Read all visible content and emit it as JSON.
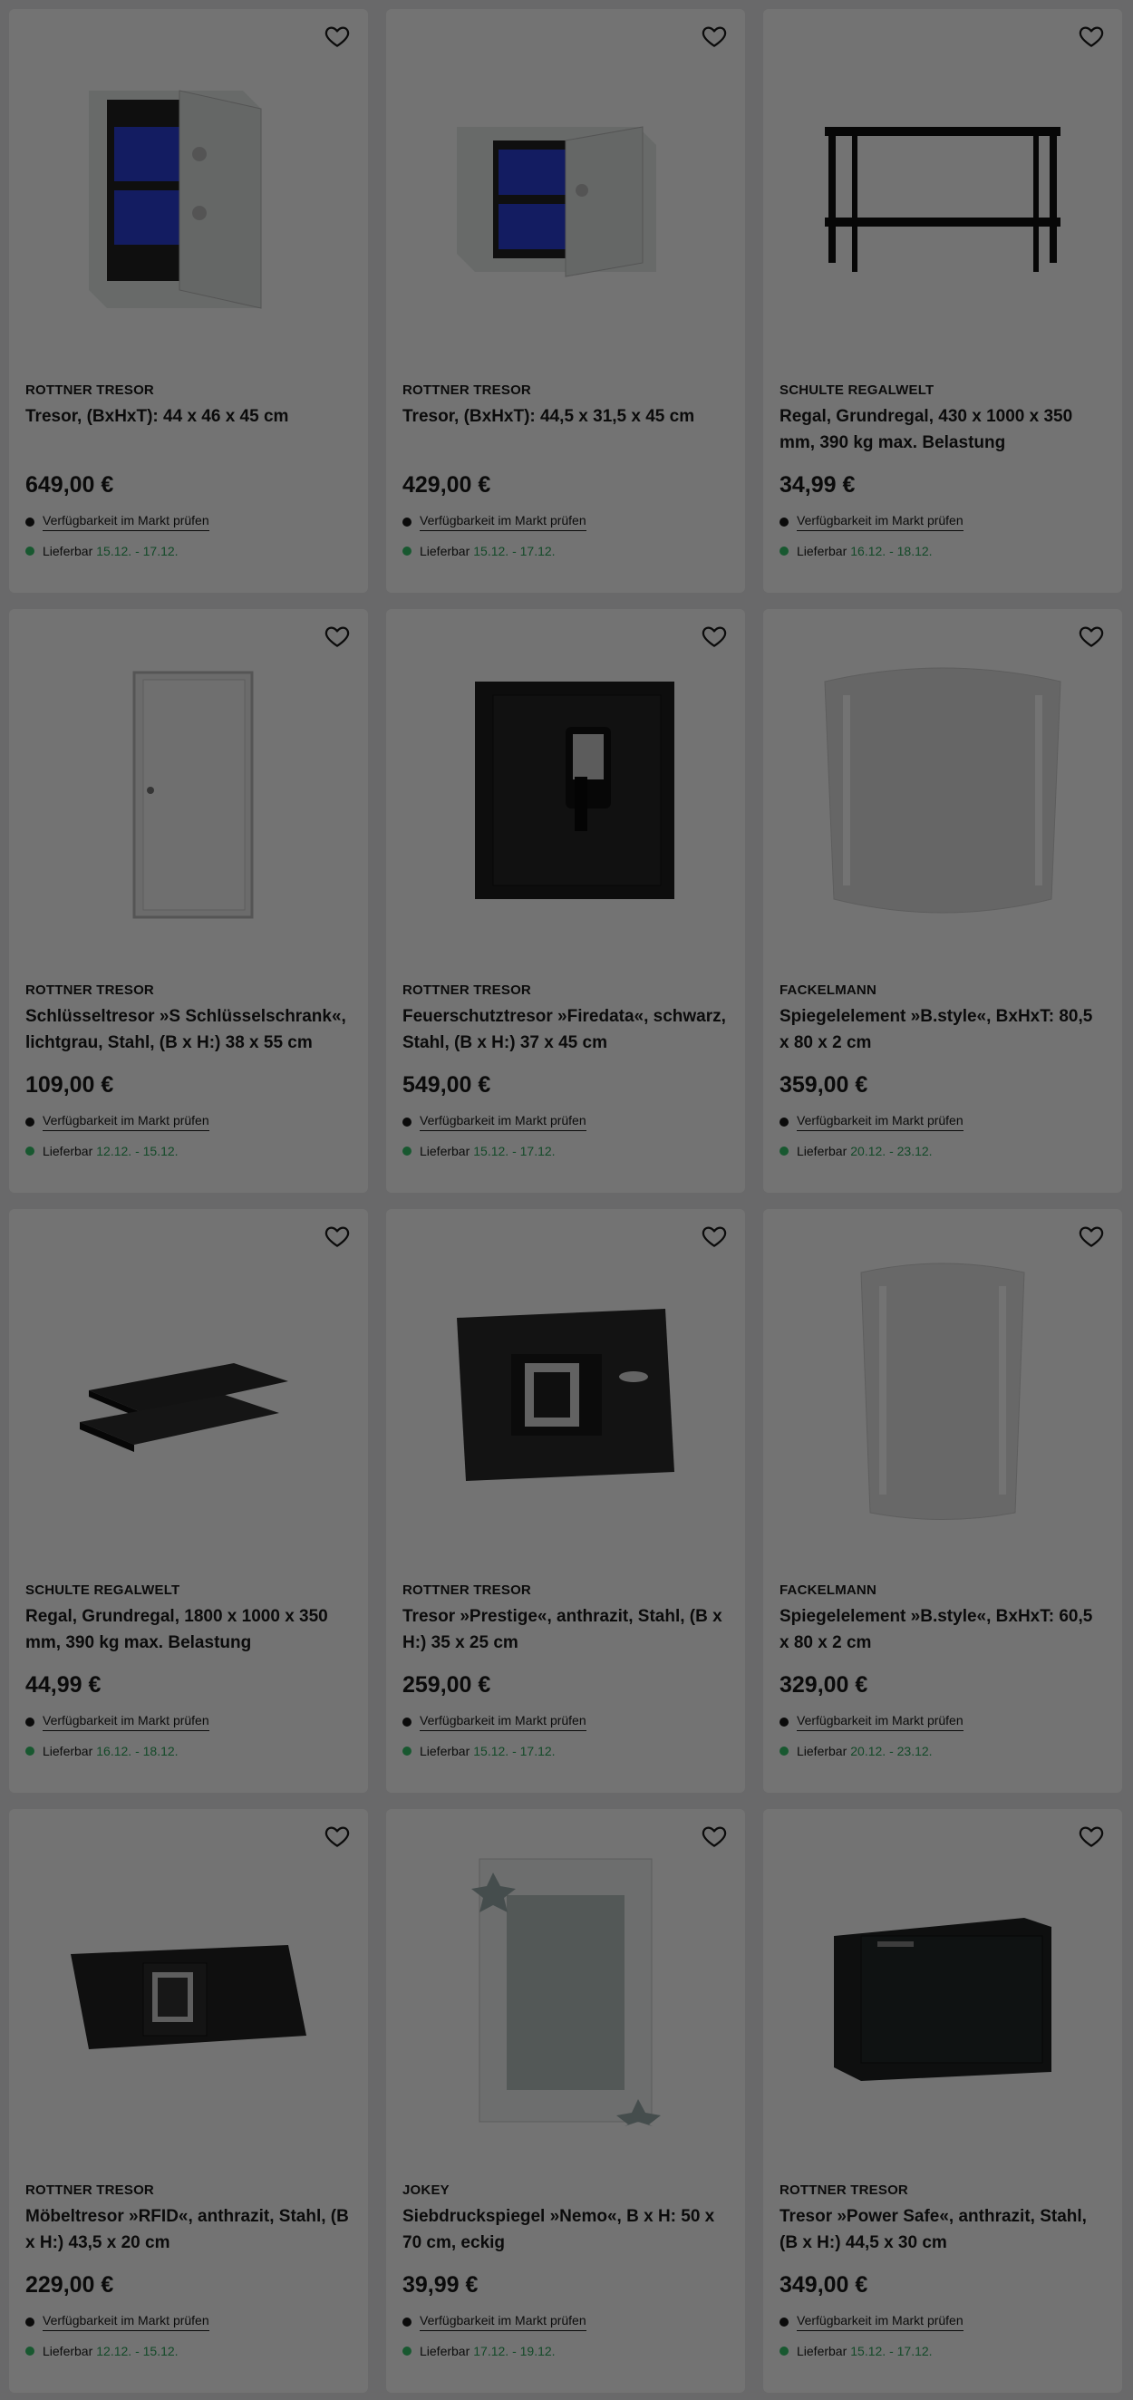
{
  "colors": {
    "accent_green": "#37c46a",
    "overlay": "rgba(0,0,0,0.55)"
  },
  "availability_label": "Verfügbarkeit im Markt prüfen",
  "delivery_label": "Lieferbar",
  "products": [
    {
      "brand": "ROTTNER TRESOR",
      "title": "Tresor, (BxHxT): 44 x 46 x 45 cm",
      "price": "649,00 €",
      "delivery": "15.12. - 17.12.",
      "image": "safe-open-white"
    },
    {
      "brand": "ROTTNER TRESOR",
      "title": "Tresor, (BxHxT): 44,5 x 31,5 x 45 cm",
      "price": "429,00 €",
      "delivery": "15.12. - 17.12.",
      "image": "safe-open-white-wide"
    },
    {
      "brand": "SCHULTE REGALWELT",
      "title": "Regal, Grundregal, 430 x 1000 x 350 mm, 390 kg max. Belastung",
      "price": "34,99 €",
      "delivery": "16.12. - 18.12.",
      "image": "shelf-black"
    },
    {
      "brand": "ROTTNER TRESOR",
      "title": "Schlüsseltresor »S Schlüsselschrank«, lichtgrau, Stahl, (B x H:) 38 x 55 cm",
      "price": "109,00 €",
      "delivery": "12.12. - 15.12.",
      "image": "key-cabinet"
    },
    {
      "brand": "ROTTNER TRESOR",
      "title": "Feuerschutztresor »Firedata«, schwarz, Stahl, (B x H:) 37 x 45 cm",
      "price": "549,00 €",
      "delivery": "15.12. - 17.12.",
      "image": "fire-safe"
    },
    {
      "brand": "FACKELMANN",
      "title": "Spiegelelement »B.style«, BxHxT: 80,5 x 80 x 2 cm",
      "price": "359,00 €",
      "delivery": "20.12. - 23.12.",
      "image": "mirror-wide"
    },
    {
      "brand": "SCHULTE REGALWELT",
      "title": "Regal, Grundregal, 1800 x 1000 x 350 mm, 390 kg max. Belastung",
      "price": "44,99 €",
      "delivery": "16.12. - 18.12.",
      "image": "shelf-boards"
    },
    {
      "brand": "ROTTNER TRESOR",
      "title": "Tresor »Prestige«, anthrazit, Stahl, (B x H:) 35 x 25 cm",
      "price": "259,00 €",
      "delivery": "15.12. - 17.12.",
      "image": "safe-prestige"
    },
    {
      "brand": "FACKELMANN",
      "title": "Spiegelelement »B.style«, BxHxT: 60,5 x 80 x 2 cm",
      "price": "329,00 €",
      "delivery": "20.12. - 23.12.",
      "image": "mirror-tall"
    },
    {
      "brand": "ROTTNER TRESOR",
      "title": "Möbeltresor »RFID«, anthrazit, Stahl, (B x H:) 43,5 x 20 cm",
      "price": "229,00 €",
      "delivery": "12.12. - 15.12.",
      "image": "safe-furniture"
    },
    {
      "brand": "JOKEY",
      "title": "Siebdruckspiegel »Nemo«, B x H: 50 x 70 cm, eckig",
      "price": "39,99 €",
      "delivery": "17.12. - 19.12.",
      "image": "mirror-nemo"
    },
    {
      "brand": "ROTTNER TRESOR",
      "title": "Tresor »Power Safe«, anthrazit, Stahl, (B x H:) 44,5 x 30 cm",
      "price": "349,00 €",
      "delivery": "15.12. - 17.12.",
      "image": "safe-power"
    }
  ]
}
